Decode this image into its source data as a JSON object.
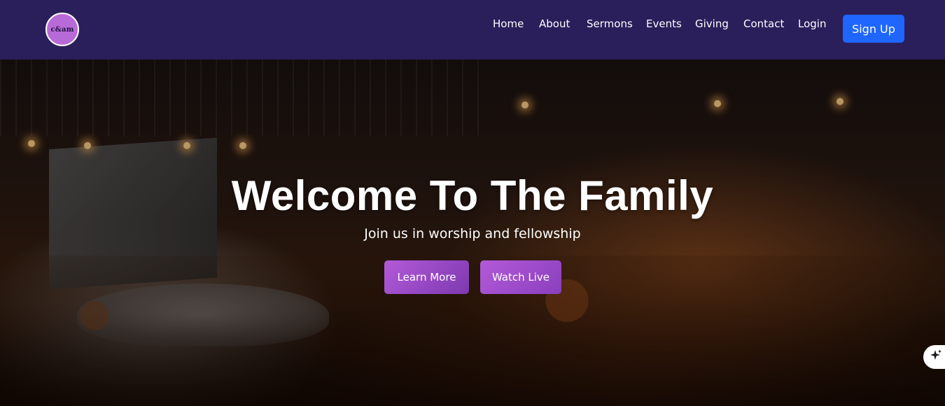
{
  "nav": {
    "logo_text": "c&am",
    "links": [
      "Home",
      "About",
      "Sermons",
      "Events",
      "Giving",
      "Contact",
      "Login"
    ],
    "signup_label": "Sign Up"
  },
  "hero": {
    "title": "Welcome To The Family",
    "subtitle": "Join us in worship and fellowship",
    "learn_more_label": "Learn More",
    "watch_live_label": "Watch Live"
  },
  "colors": {
    "navbar_bg": "#2a1f5b",
    "signup_bg": "#1f66ff",
    "button_purple": "#b35ad9"
  },
  "icons": {
    "floating_button": "sparkle-icon"
  }
}
